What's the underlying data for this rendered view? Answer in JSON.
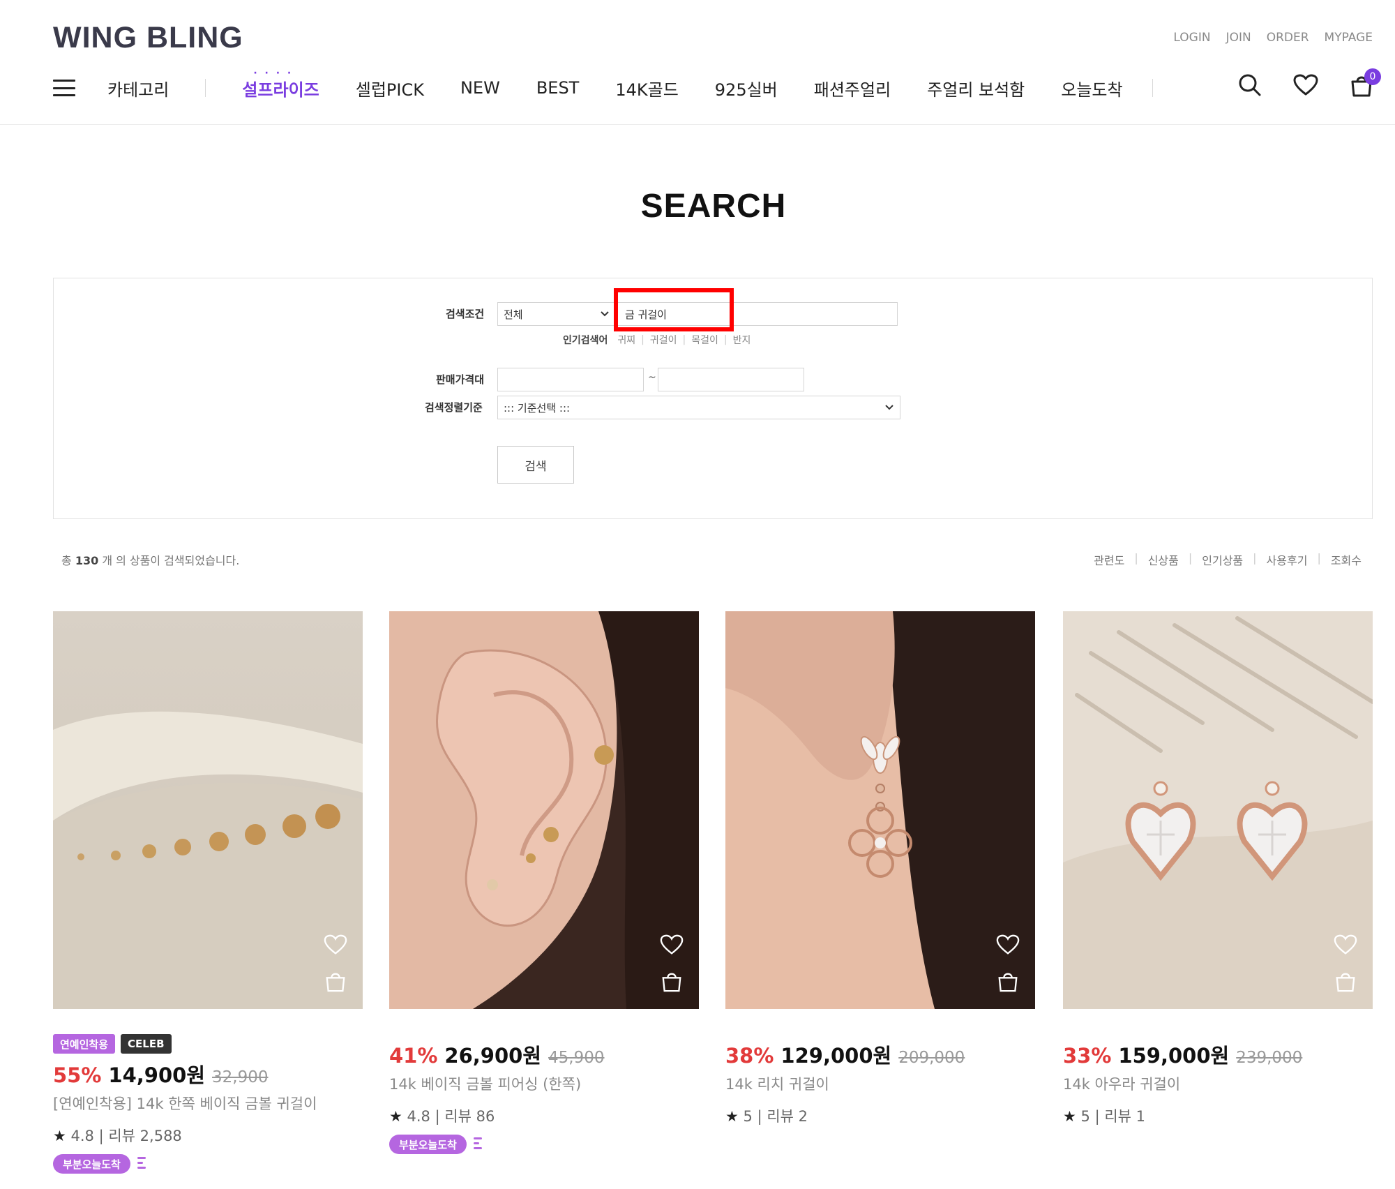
{
  "header": {
    "logo": "WING BLING",
    "top_links": [
      "LOGIN",
      "JOIN",
      "ORDER",
      "MYPAGE"
    ],
    "category_label": "카테고리",
    "nav_items": [
      "설프라이즈",
      "셀럽PICK",
      "NEW",
      "BEST",
      "14K골드",
      "925실버",
      "패션주얼리",
      "주얼리 보석함",
      "오늘도착"
    ],
    "cart_count": "0",
    "accent_color": "#7a3de0"
  },
  "search": {
    "title": "SEARCH",
    "condition_label": "검색조건",
    "condition_value": "전체",
    "keyword": "금 귀걸이",
    "popular_label": "인기검색어",
    "popular_terms": [
      "귀찌",
      "귀걸이",
      "목걸이",
      "반지"
    ],
    "price_label": "판매가격대",
    "price_min": "",
    "price_max": "",
    "price_separator": "~",
    "sort_label": "검색정렬기준",
    "sort_value": "::: 기준선택 :::",
    "button_label": "검색"
  },
  "results": {
    "prefix": "총",
    "count": "130",
    "suffix": "개 의 상품이 검색되었습니다.",
    "sort_options": [
      "관련도",
      "신상품",
      "인기상품",
      "사용후기",
      "조회수"
    ]
  },
  "products": [
    {
      "tags": [
        "연예인착용",
        "CELEB"
      ],
      "discount": "55%",
      "price": "14,900원",
      "original_price": "32,900",
      "name": "[연예인착용] 14k 한쪽 베이직 금볼 귀걸이",
      "rating": "4.8",
      "reviews_label": "리뷰 2,588",
      "badge": "부분오늘도착"
    },
    {
      "tags": [],
      "discount": "41%",
      "price": "26,900원",
      "original_price": "45,900",
      "name": "14k 베이직 금볼 피어싱 (한쪽)",
      "rating": "4.8",
      "reviews_label": "리뷰 86",
      "badge": "부분오늘도착"
    },
    {
      "tags": [],
      "discount": "38%",
      "price": "129,000원",
      "original_price": "209,000",
      "name": "14k 리치 귀걸이",
      "rating": "5",
      "reviews_label": "리뷰 2",
      "badge": ""
    },
    {
      "tags": [],
      "discount": "33%",
      "price": "159,000원",
      "original_price": "239,000",
      "name": "14k 아우라 귀걸이",
      "rating": "5",
      "reviews_label": "리뷰 1",
      "badge": ""
    }
  ]
}
